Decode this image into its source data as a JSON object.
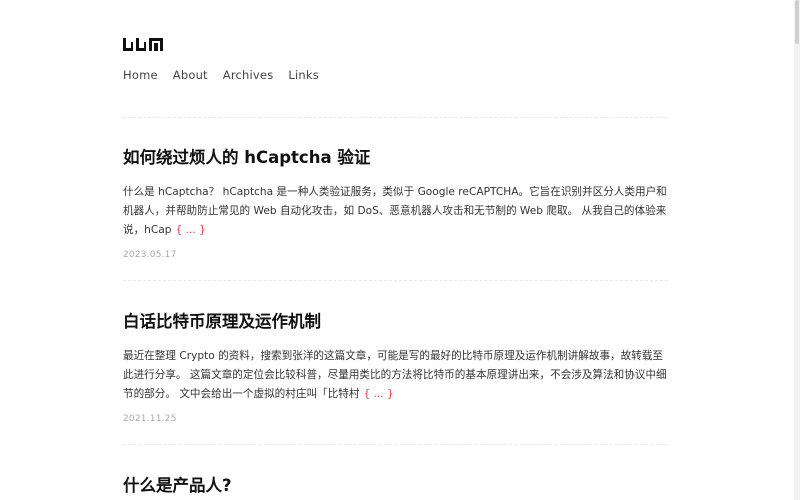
{
  "header": {
    "logo_alt": "LLN",
    "nav": [
      {
        "label": "Home"
      },
      {
        "label": "About"
      },
      {
        "label": "Archives"
      },
      {
        "label": "Links"
      }
    ]
  },
  "posts": [
    {
      "title": "如何绕过烦人的 hCaptcha 验证",
      "excerpt": "什么是 hCaptcha？ hCaptcha 是一种人类验证服务，类似于 Google reCAPTCHA。它旨在识别并区分人类用户和机器人，并帮助防止常见的 Web 自动化攻击，如 DoS、恶意机器人攻击和无节制的 Web 爬取。 从我自己的体验来说，hCap",
      "more": "{ ... }",
      "date": "2023.05.17"
    },
    {
      "title": "白话比特币原理及运作机制",
      "excerpt": "最近在整理 Crypto 的资料，搜索到张洋的这篇文章，可能是写的最好的比特币原理及运作机制讲解故事，故转载至此进行分享。 这篇文章的定位会比较科普，尽量用类比的方法将比特币的基本原理讲出来，不会涉及算法和协议中细节的部分。 文中会给出一个虚拟的村庄叫「比特村",
      "more": "{ ... }",
      "date": "2021.11.25"
    },
    {
      "title": "什么是产品人?"
    }
  ]
}
